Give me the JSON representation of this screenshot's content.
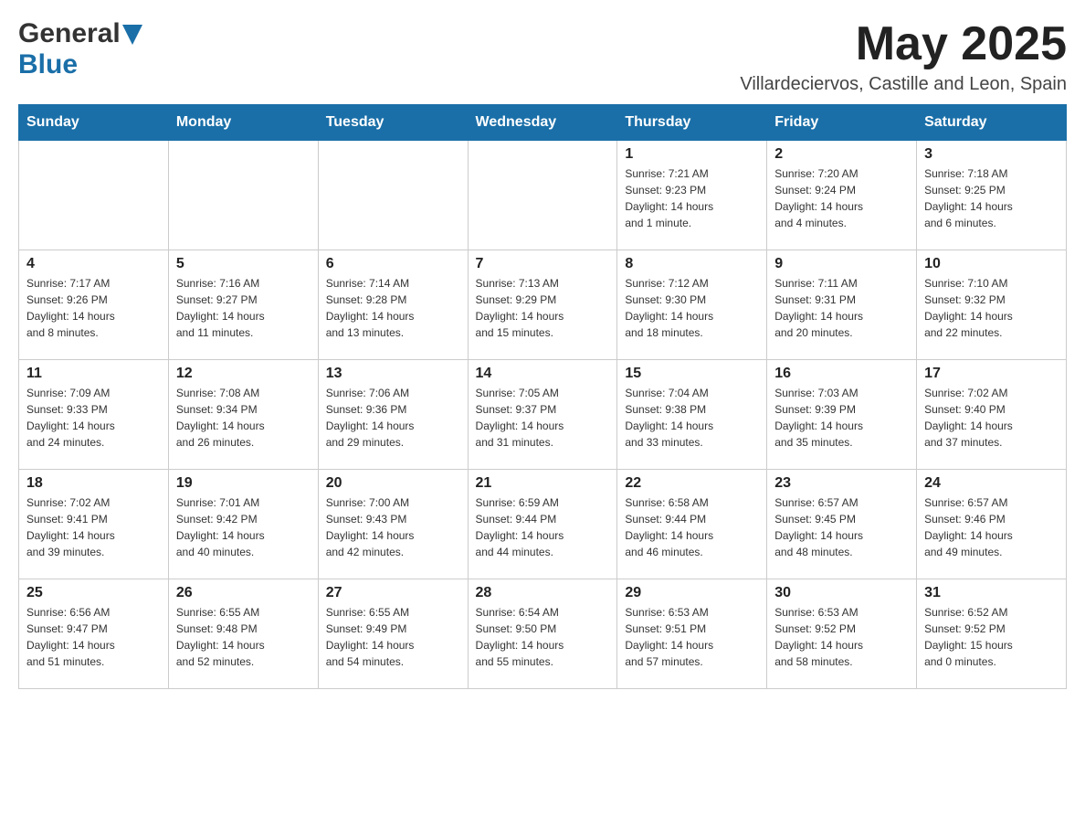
{
  "header": {
    "logo_general": "General",
    "logo_blue": "Blue",
    "month_year": "May 2025",
    "location": "Villardeciervos, Castille and Leon, Spain"
  },
  "days_of_week": [
    "Sunday",
    "Monday",
    "Tuesday",
    "Wednesday",
    "Thursday",
    "Friday",
    "Saturday"
  ],
  "weeks": [
    [
      {
        "day": "",
        "info": ""
      },
      {
        "day": "",
        "info": ""
      },
      {
        "day": "",
        "info": ""
      },
      {
        "day": "",
        "info": ""
      },
      {
        "day": "1",
        "info": "Sunrise: 7:21 AM\nSunset: 9:23 PM\nDaylight: 14 hours\nand 1 minute."
      },
      {
        "day": "2",
        "info": "Sunrise: 7:20 AM\nSunset: 9:24 PM\nDaylight: 14 hours\nand 4 minutes."
      },
      {
        "day": "3",
        "info": "Sunrise: 7:18 AM\nSunset: 9:25 PM\nDaylight: 14 hours\nand 6 minutes."
      }
    ],
    [
      {
        "day": "4",
        "info": "Sunrise: 7:17 AM\nSunset: 9:26 PM\nDaylight: 14 hours\nand 8 minutes."
      },
      {
        "day": "5",
        "info": "Sunrise: 7:16 AM\nSunset: 9:27 PM\nDaylight: 14 hours\nand 11 minutes."
      },
      {
        "day": "6",
        "info": "Sunrise: 7:14 AM\nSunset: 9:28 PM\nDaylight: 14 hours\nand 13 minutes."
      },
      {
        "day": "7",
        "info": "Sunrise: 7:13 AM\nSunset: 9:29 PM\nDaylight: 14 hours\nand 15 minutes."
      },
      {
        "day": "8",
        "info": "Sunrise: 7:12 AM\nSunset: 9:30 PM\nDaylight: 14 hours\nand 18 minutes."
      },
      {
        "day": "9",
        "info": "Sunrise: 7:11 AM\nSunset: 9:31 PM\nDaylight: 14 hours\nand 20 minutes."
      },
      {
        "day": "10",
        "info": "Sunrise: 7:10 AM\nSunset: 9:32 PM\nDaylight: 14 hours\nand 22 minutes."
      }
    ],
    [
      {
        "day": "11",
        "info": "Sunrise: 7:09 AM\nSunset: 9:33 PM\nDaylight: 14 hours\nand 24 minutes."
      },
      {
        "day": "12",
        "info": "Sunrise: 7:08 AM\nSunset: 9:34 PM\nDaylight: 14 hours\nand 26 minutes."
      },
      {
        "day": "13",
        "info": "Sunrise: 7:06 AM\nSunset: 9:36 PM\nDaylight: 14 hours\nand 29 minutes."
      },
      {
        "day": "14",
        "info": "Sunrise: 7:05 AM\nSunset: 9:37 PM\nDaylight: 14 hours\nand 31 minutes."
      },
      {
        "day": "15",
        "info": "Sunrise: 7:04 AM\nSunset: 9:38 PM\nDaylight: 14 hours\nand 33 minutes."
      },
      {
        "day": "16",
        "info": "Sunrise: 7:03 AM\nSunset: 9:39 PM\nDaylight: 14 hours\nand 35 minutes."
      },
      {
        "day": "17",
        "info": "Sunrise: 7:02 AM\nSunset: 9:40 PM\nDaylight: 14 hours\nand 37 minutes."
      }
    ],
    [
      {
        "day": "18",
        "info": "Sunrise: 7:02 AM\nSunset: 9:41 PM\nDaylight: 14 hours\nand 39 minutes."
      },
      {
        "day": "19",
        "info": "Sunrise: 7:01 AM\nSunset: 9:42 PM\nDaylight: 14 hours\nand 40 minutes."
      },
      {
        "day": "20",
        "info": "Sunrise: 7:00 AM\nSunset: 9:43 PM\nDaylight: 14 hours\nand 42 minutes."
      },
      {
        "day": "21",
        "info": "Sunrise: 6:59 AM\nSunset: 9:44 PM\nDaylight: 14 hours\nand 44 minutes."
      },
      {
        "day": "22",
        "info": "Sunrise: 6:58 AM\nSunset: 9:44 PM\nDaylight: 14 hours\nand 46 minutes."
      },
      {
        "day": "23",
        "info": "Sunrise: 6:57 AM\nSunset: 9:45 PM\nDaylight: 14 hours\nand 48 minutes."
      },
      {
        "day": "24",
        "info": "Sunrise: 6:57 AM\nSunset: 9:46 PM\nDaylight: 14 hours\nand 49 minutes."
      }
    ],
    [
      {
        "day": "25",
        "info": "Sunrise: 6:56 AM\nSunset: 9:47 PM\nDaylight: 14 hours\nand 51 minutes."
      },
      {
        "day": "26",
        "info": "Sunrise: 6:55 AM\nSunset: 9:48 PM\nDaylight: 14 hours\nand 52 minutes."
      },
      {
        "day": "27",
        "info": "Sunrise: 6:55 AM\nSunset: 9:49 PM\nDaylight: 14 hours\nand 54 minutes."
      },
      {
        "day": "28",
        "info": "Sunrise: 6:54 AM\nSunset: 9:50 PM\nDaylight: 14 hours\nand 55 minutes."
      },
      {
        "day": "29",
        "info": "Sunrise: 6:53 AM\nSunset: 9:51 PM\nDaylight: 14 hours\nand 57 minutes."
      },
      {
        "day": "30",
        "info": "Sunrise: 6:53 AM\nSunset: 9:52 PM\nDaylight: 14 hours\nand 58 minutes."
      },
      {
        "day": "31",
        "info": "Sunrise: 6:52 AM\nSunset: 9:52 PM\nDaylight: 15 hours\nand 0 minutes."
      }
    ]
  ]
}
